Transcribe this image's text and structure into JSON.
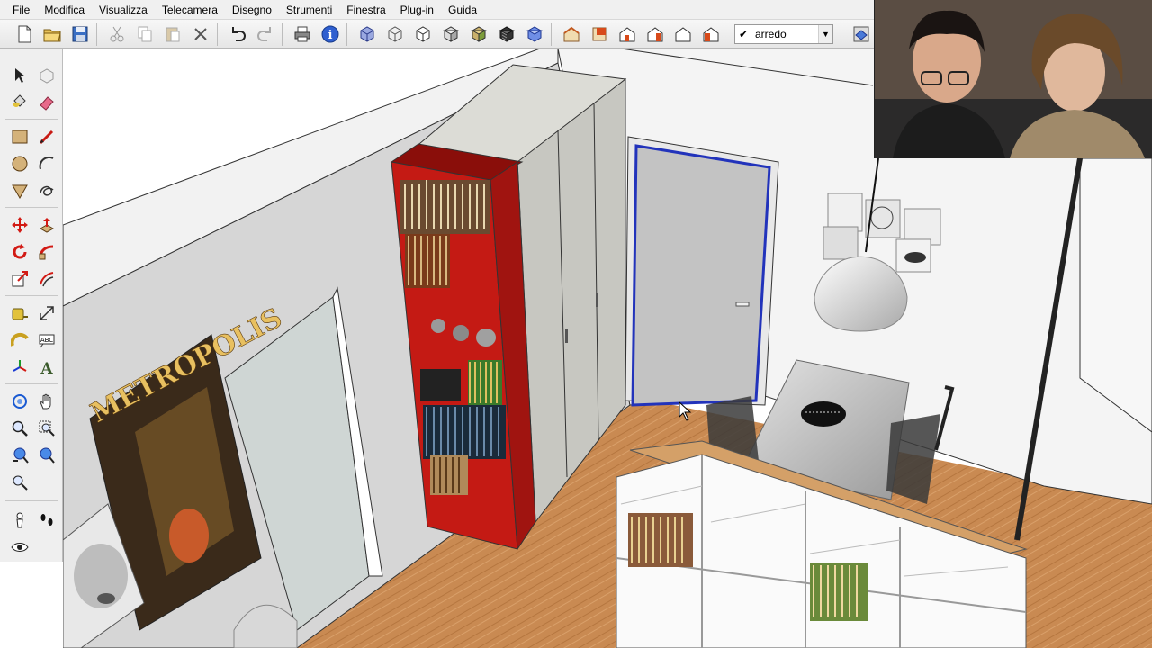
{
  "menu": {
    "items": [
      "File",
      "Modifica",
      "Visualizza",
      "Telecamera",
      "Disegno",
      "Strumenti",
      "Finestra",
      "Plug-in",
      "Guida"
    ]
  },
  "toolbar": {
    "layer": {
      "checked": "✔",
      "name": "arredo"
    }
  },
  "scene": {
    "poster_title": "METROPOLIS"
  },
  "colors": {
    "accent_blue": "#2233bb",
    "bookcase_red": "#c41a14",
    "wood_floor": "#c98a52",
    "wall_grey": "#d6d6d6"
  }
}
